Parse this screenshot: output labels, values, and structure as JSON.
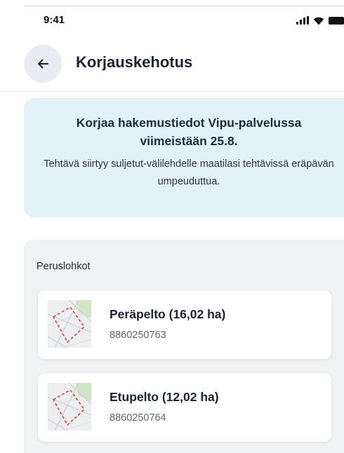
{
  "status_bar": {
    "time": "9:41",
    "icons": [
      "signal-icon",
      "wifi-icon",
      "battery-icon"
    ]
  },
  "header": {
    "back_icon": "arrow-left-icon",
    "title": "Korjauskehotus"
  },
  "notice": {
    "title": "Korjaa hakemustiedot Vipu-palvelussa viimeistään 25.8.",
    "body": "Tehtävä siirtyy suljetut-välilehdelle maatilasi tehtävissä eräpävän umpeuduttua."
  },
  "parcels": {
    "section_label": "Peruslohkot",
    "items": [
      {
        "name": "Peräpelto (16,02 ha)",
        "id": "8860250763",
        "thumb_icon": "parcel-map-thumbnail"
      },
      {
        "name": "Etupelto (12,02 ha)",
        "id": "8860250764",
        "thumb_icon": "parcel-map-thumbnail"
      }
    ]
  },
  "colors": {
    "notice_background": "#e3f1f8",
    "section_background": "#f1f2f4",
    "back_button_background": "#e9edf2",
    "parcel_outline": "#e0443a"
  }
}
